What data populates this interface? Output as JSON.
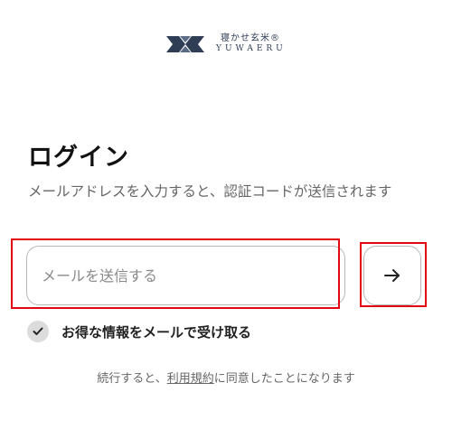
{
  "brand": {
    "name_jp": "寝かせ玄米®",
    "name_en": "YUWAERU",
    "colors": {
      "logo": "#2f3e55",
      "highlight": "#e30613"
    }
  },
  "login": {
    "title": "ログイン",
    "description": "メールアドレスを入力すると、認証コードが送信されます",
    "email_placeholder": "メールを送信する",
    "submit_icon": "arrow-right-icon"
  },
  "optin": {
    "checked": true,
    "label": "お得な情報をメールで受け取る"
  },
  "terms": {
    "prefix": "続行すると、",
    "link": "利用規約",
    "suffix": "に同意したことになります"
  }
}
